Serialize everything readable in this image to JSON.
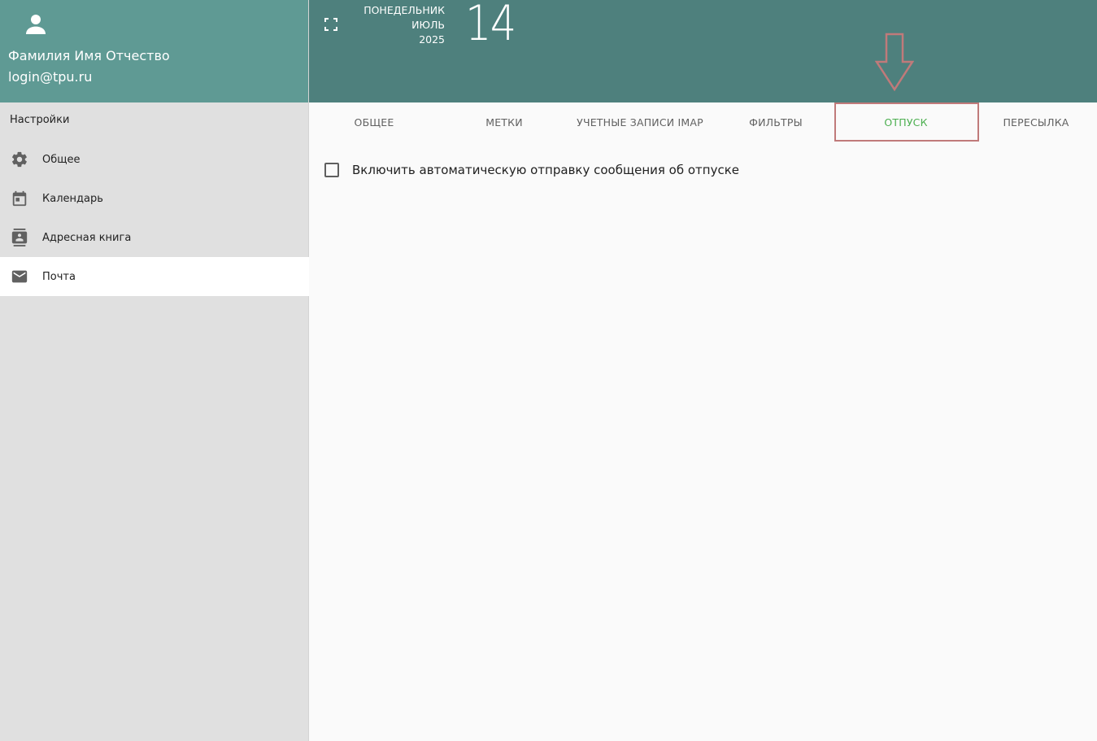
{
  "profile": {
    "name": "Фамилия Имя Отчество",
    "login": "login@tpu.ru"
  },
  "sidebar": {
    "title": "Настройки",
    "items": [
      {
        "label": "Общее",
        "icon": "gear-icon"
      },
      {
        "label": "Календарь",
        "icon": "calendar-icon"
      },
      {
        "label": "Адресная книга",
        "icon": "contacts-icon"
      },
      {
        "label": "Почта",
        "icon": "mail-icon",
        "active": true
      }
    ]
  },
  "header": {
    "weekday": "ПОНЕДЕЛЬНИК",
    "month": "ИЮЛЬ",
    "year": "2025",
    "day": "14"
  },
  "tabs": [
    {
      "label": "ОБЩЕЕ"
    },
    {
      "label": "МЕТКИ"
    },
    {
      "label": "УЧЕТНЫЕ ЗАПИСИ IMAP"
    },
    {
      "label": "ФИЛЬТРЫ"
    },
    {
      "label": "ОТПУСК",
      "active": true
    },
    {
      "label": "ПЕРЕСЫЛКА"
    }
  ],
  "vacation": {
    "enable_label": "Включить автоматическую отправку сообщения об отпуске",
    "checked": false
  },
  "colors": {
    "profile_bg": "#5f9a94",
    "header_bg": "#4e807d",
    "sidebar_bg": "#e0e0e0",
    "active_tab": "#4caf50",
    "annotation": "#c07a7a"
  }
}
